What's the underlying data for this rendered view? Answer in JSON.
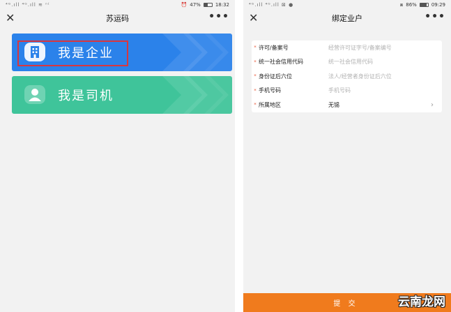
{
  "left_screen": {
    "status_bar": {
      "signal_text": "⁴ᴳ.ıll ⁴ᴳ.ıll ≋ ⁿ⁽",
      "battery": "47%",
      "time": "18:32",
      "battery_level": 0.47
    },
    "nav": {
      "title": "苏运码",
      "close_icon": "close-icon",
      "more_icon": "more-icon"
    },
    "cards": [
      {
        "label": "我是企业",
        "icon": "building-icon",
        "color": "#2b82ea"
      },
      {
        "label": "我是司机",
        "icon": "driver-icon",
        "color": "#3fc49a"
      }
    ]
  },
  "right_screen": {
    "status_bar": {
      "signal_text": "⁴ᴳ.ıll ⁴ᴳ.ıll ⊠ ●",
      "battery": "86%",
      "time": "09:29",
      "battery_level": 0.86
    },
    "nav": {
      "title": "绑定业户",
      "close_icon": "close-icon",
      "more_icon": "more-icon"
    },
    "form": [
      {
        "label": "许可/备案号",
        "placeholder": "经营许可证字号/备案编号"
      },
      {
        "label": "统一社会信用代码",
        "placeholder": "统一社会信用代码"
      },
      {
        "label": "身份证后六位",
        "placeholder": "法人/经营者身份证后六位"
      },
      {
        "label": "手机号码",
        "placeholder": "手机号码"
      },
      {
        "label": "所属地区",
        "value": "无锡"
      }
    ],
    "submit_label": "提 交",
    "watermark": "云南龙网"
  }
}
